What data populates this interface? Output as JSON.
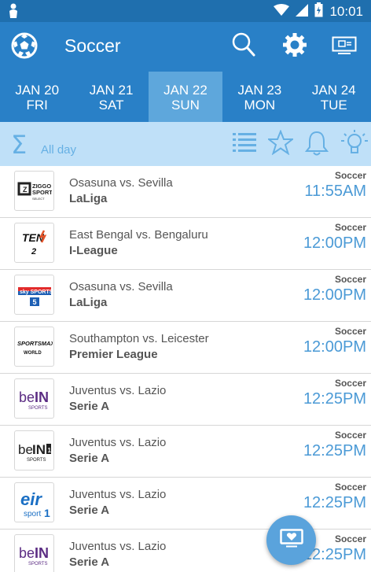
{
  "status_bar": {
    "time": "10:01",
    "icons": [
      "person-icon",
      "wifi-icon",
      "signal-icon",
      "battery-icon"
    ]
  },
  "app": {
    "title": "Soccer",
    "icons": [
      "soccer-ball-icon",
      "search-icon",
      "settings-gear-icon",
      "cast-tv-icon"
    ]
  },
  "dates": [
    {
      "month_day": "JAN 20",
      "weekday": "FRI"
    },
    {
      "month_day": "JAN 21",
      "weekday": "SAT"
    },
    {
      "month_day": "JAN 22",
      "weekday": "SUN",
      "active": true
    },
    {
      "month_day": "JAN 23",
      "weekday": "MON"
    },
    {
      "month_day": "JAN 24",
      "weekday": "TUE"
    }
  ],
  "filter": {
    "sigma": "Σ",
    "label": "All day",
    "icons": [
      "list-icon",
      "star-icon",
      "bell-icon",
      "lightbulb-icon"
    ]
  },
  "listings": [
    {
      "channel": "ZIGGO SPORT SELECT",
      "match": "Osasuna vs. Sevilla",
      "league": "LaLiga",
      "sport": "Soccer",
      "time": "11:55AM"
    },
    {
      "channel": "TEN 2",
      "match": "East Bengal vs. Bengaluru",
      "league": "I-League",
      "sport": "Soccer",
      "time": "12:00PM"
    },
    {
      "channel": "SKY SPORTS 5",
      "match": "Osasuna vs. Sevilla",
      "league": "LaLiga",
      "sport": "Soccer",
      "time": "12:00PM"
    },
    {
      "channel": "SPORTSMAX WORLD",
      "match": "Southampton vs. Leicester",
      "league": "Premier League",
      "sport": "Soccer",
      "time": "12:00PM"
    },
    {
      "channel": "beIN SPORTS",
      "match": "Juventus vs. Lazio",
      "league": "Serie A",
      "sport": "Soccer",
      "time": "12:25PM"
    },
    {
      "channel": "beIN SPORTS 1",
      "match": "Juventus vs. Lazio",
      "league": "Serie A",
      "sport": "Soccer",
      "time": "12:25PM"
    },
    {
      "channel": "eir sport 1",
      "match": "Juventus vs. Lazio",
      "league": "Serie A",
      "sport": "Soccer",
      "time": "12:25PM"
    },
    {
      "channel": "beIN SPORTS",
      "match": "Juventus vs. Lazio",
      "league": "Serie A",
      "sport": "Soccer",
      "time": "12:25PM"
    }
  ],
  "colors": {
    "primary": "#2980c7",
    "status": "#1f6fae",
    "active_tab": "#5ea7dc",
    "filter_bg": "#bfe0f8",
    "accent_text": "#4b9ad6"
  }
}
